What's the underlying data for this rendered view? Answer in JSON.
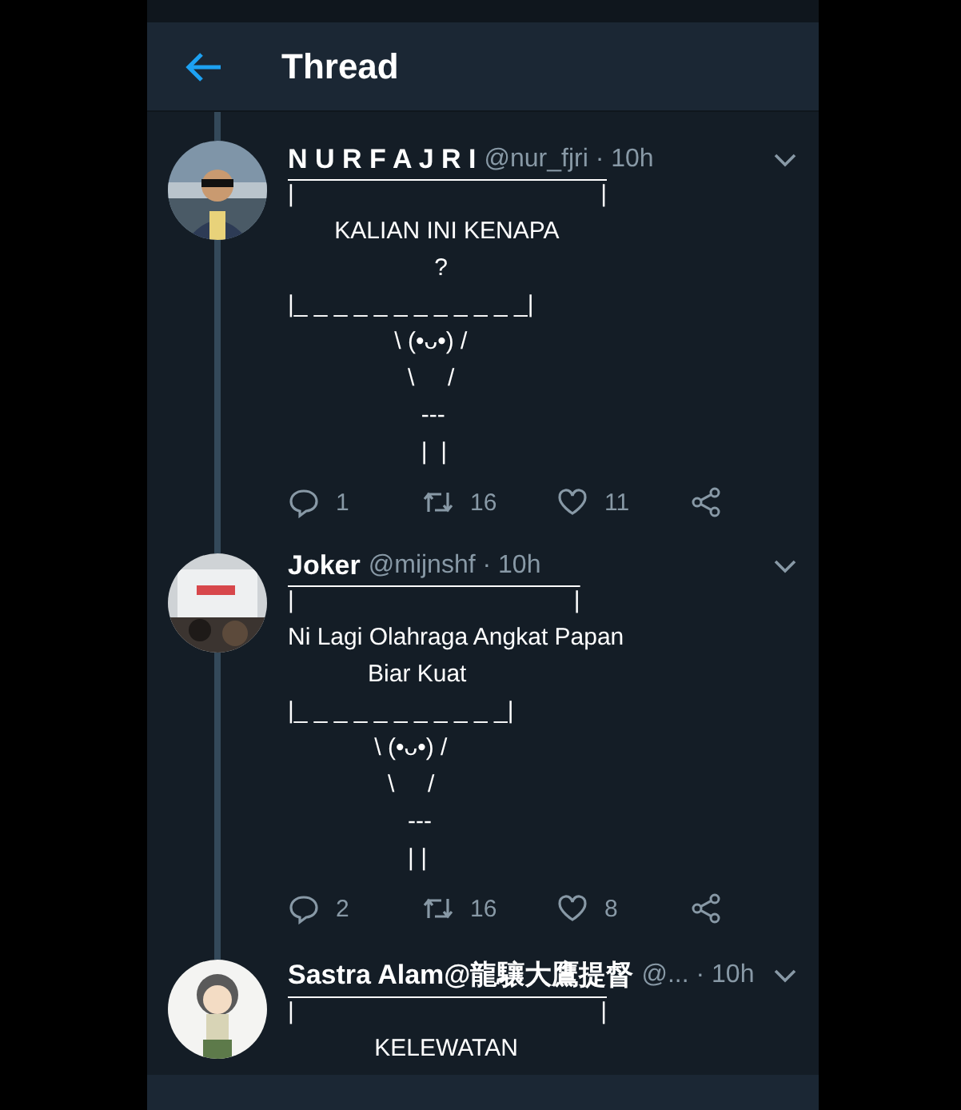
{
  "header": {
    "title": "Thread"
  },
  "tweets": [
    {
      "name": "N U R F A J R I",
      "handle": "@nur_fjri · 10h",
      "lines": [
        {
          "kind": "box-top",
          "text": "|                                              |"
        },
        {
          "kind": "text",
          "text": "       KALIAN INI KENAPA"
        },
        {
          "kind": "text",
          "text": "                      ?"
        },
        {
          "kind": "text",
          "text": "|_ _ _ _ _ _ _ _ _ _ _ _|"
        },
        {
          "kind": "text",
          "text": "                \\ (•ᴗ•) /"
        },
        {
          "kind": "text",
          "text": "                  \\     /"
        },
        {
          "kind": "text",
          "text": "                    ---"
        },
        {
          "kind": "text",
          "text": "                    |  |"
        }
      ],
      "actions": {
        "replies": "1",
        "retweets": "16",
        "likes": "11"
      }
    },
    {
      "name": "Joker",
      "handle": "@mijnshf · 10h",
      "lines": [
        {
          "kind": "box-top",
          "text": "|                                          |"
        },
        {
          "kind": "text",
          "text": "Ni Lagi Olahraga Angkat Papan"
        },
        {
          "kind": "text",
          "text": "            Biar Kuat"
        },
        {
          "kind": "text",
          "text": "|_ _ _ _ _ _ _ _ _ _ _|"
        },
        {
          "kind": "text",
          "text": "             \\ (•ᴗ•) /"
        },
        {
          "kind": "text",
          "text": "               \\     /"
        },
        {
          "kind": "text",
          "text": "                  ---"
        },
        {
          "kind": "text",
          "text": "                  | |"
        }
      ],
      "actions": {
        "replies": "2",
        "retweets": "16",
        "likes": "8"
      }
    },
    {
      "name": "Sastra Alam@龍驤大鷹提督",
      "handle": "@... · 10h",
      "lines": [
        {
          "kind": "box-top",
          "text": "|                                              |"
        },
        {
          "kind": "text",
          "text": "             KELEWATAN"
        }
      ]
    }
  ]
}
